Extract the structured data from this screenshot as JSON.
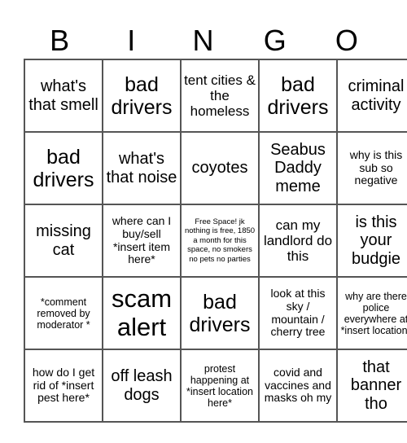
{
  "header": [
    "B",
    "I",
    "N",
    "G",
    "O"
  ],
  "rows": [
    [
      "what's that smell",
      "bad drivers",
      "tent cities & the homeless",
      "bad drivers",
      "criminal activity"
    ],
    [
      "bad drivers",
      "what's that noise",
      "coyotes",
      "Seabus Daddy meme",
      "why is this sub so negative"
    ],
    [
      "missing cat",
      "where can I buy/sell *insert item here*",
      "Free Space! jk nothing is free, 1850 a month for this space, no smokers no pets no parties",
      "can my landlord do this",
      "is this your budgie"
    ],
    [
      "*comment removed by moderator *",
      "scam alert",
      "bad drivers",
      "look at this sky / mountain / cherry tree",
      "why are there police everywhere at *insert location*"
    ],
    [
      "how do I get rid of *insert pest here*",
      "off leash dogs",
      "protest happening at *insert location here*",
      "covid and vaccines and masks oh my",
      "that banner tho"
    ]
  ]
}
